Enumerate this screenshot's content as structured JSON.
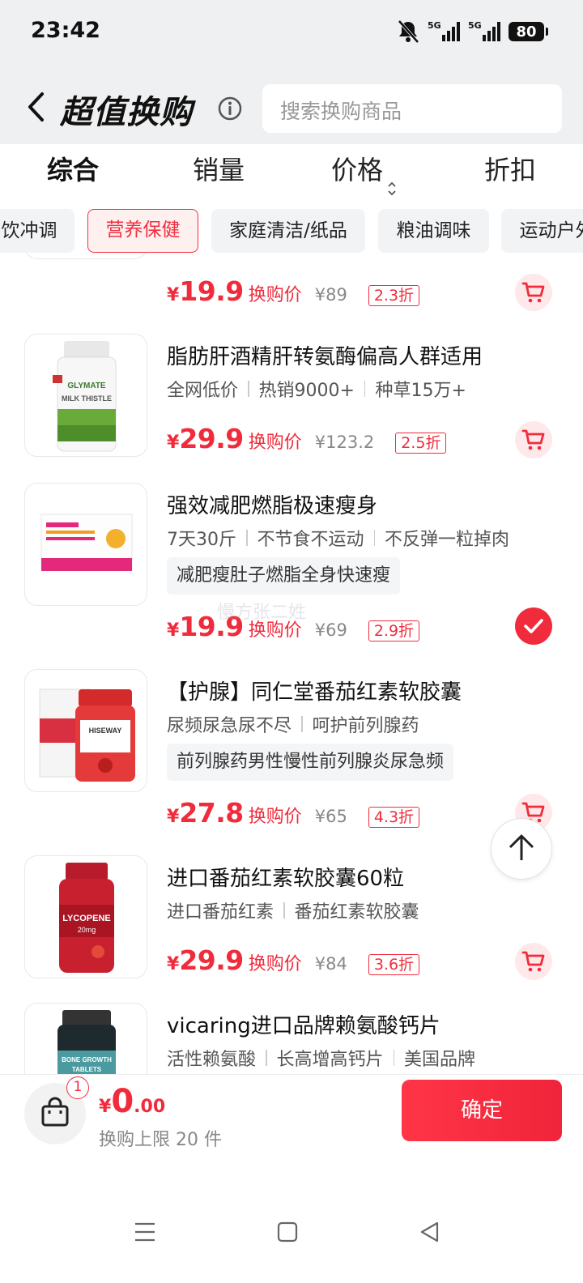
{
  "status": {
    "time": "23:42",
    "battery": "80",
    "net1": "5G",
    "net2": "5G"
  },
  "header": {
    "title": "超值换购",
    "search_placeholder": "搜索换购商品"
  },
  "sort_tabs": [
    "综合",
    "销量",
    "价格",
    "折扣"
  ],
  "chips": [
    "饮冲调",
    "营养保健",
    "家庭清洁/纸品",
    "粮油调味",
    "运动户外"
  ],
  "items": [
    {
      "title": "",
      "tags": [],
      "keyword": "",
      "price": "19.9",
      "price_label": "换购价",
      "original": "¥89",
      "discount": "2.3折",
      "selected": false
    },
    {
      "title": "脂肪肝酒精肝转氨酶偏高人群适用",
      "tags": [
        "全网低价",
        "热销9000+",
        "种草15万+"
      ],
      "keyword": "",
      "price": "29.9",
      "price_label": "换购价",
      "original": "¥123.2",
      "discount": "2.5折",
      "selected": false,
      "image_text": [
        "GLYMATE",
        "MILK THISTLE"
      ]
    },
    {
      "title": "强效减肥燃脂极速瘦身",
      "tags": [
        "7天30斤",
        "不节食不运动",
        "不反弹一粒掉肉"
      ],
      "keyword": "减肥瘦肚子燃脂全身快速瘦",
      "price": "19.9",
      "price_label": "换购价",
      "original": "¥69",
      "discount": "2.9折",
      "selected": true
    },
    {
      "title": "【护腺】同仁堂番茄红素软胶囊",
      "tags": [
        "尿频尿急尿不尽",
        "呵护前列腺药"
      ],
      "keyword": "前列腺药男性慢性前列腺炎尿急频",
      "price": "27.8",
      "price_label": "换购价",
      "original": "¥65",
      "discount": "4.3折",
      "selected": false,
      "image_text": [
        "HISEWAY"
      ]
    },
    {
      "title": "进口番茄红素软胶囊60粒",
      "tags": [
        "进口番茄红素",
        "番茄红素软胶囊"
      ],
      "keyword": "",
      "price": "29.9",
      "price_label": "换购价",
      "original": "¥84",
      "discount": "3.6折",
      "selected": false,
      "image_text": [
        "LYCOPENE",
        "20mg"
      ]
    },
    {
      "title": "vicaring进口品牌赖氨酸钙片",
      "tags": [
        "活性赖氨酸",
        "长高增高钙片",
        "美国品牌"
      ],
      "keyword": "",
      "price": "",
      "price_label": "",
      "original": "",
      "discount": "",
      "selected": false,
      "image_text": [
        "BONE GROWTH",
        "TABLETS"
      ]
    }
  ],
  "watermark": "慢方张二姓",
  "bottom": {
    "cart_count": "1",
    "currency": "¥",
    "total_int": "0",
    "total_dec": ".00",
    "limit_text": "换购上限 20 件",
    "confirm": "确定"
  },
  "colors": {
    "accent": "#f02c3c",
    "header_bg": "#eff0f1"
  }
}
